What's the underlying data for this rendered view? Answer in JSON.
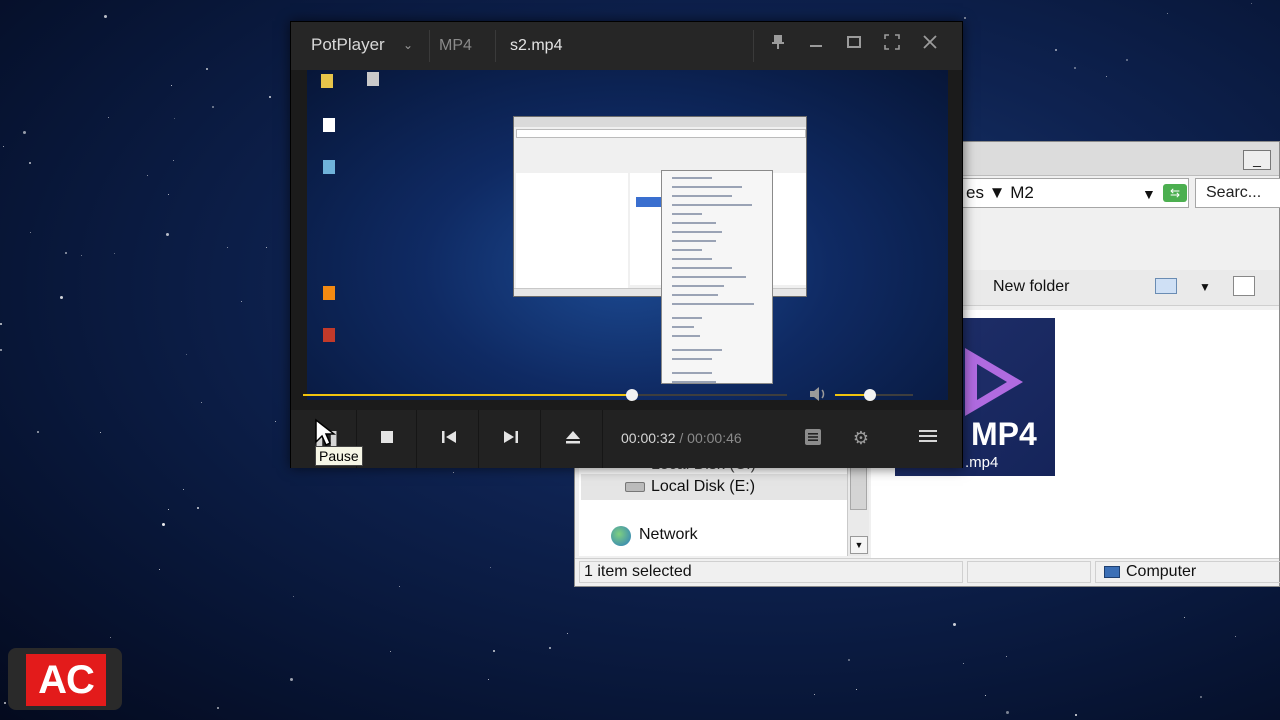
{
  "player": {
    "app_name": "PotPlayer",
    "format": "MP4",
    "file_name": "s2.mp4",
    "time_current": "00:00:32",
    "time_separator": "/",
    "time_total": "00:00:46",
    "seek_progress": 0.68,
    "volume_level": 0.45,
    "tooltip": "Pause"
  },
  "explorer": {
    "address": "es ▼ M2",
    "search_placeholder": "Searc...",
    "new_folder_label": "New folder",
    "nav_partial": "Local Disk (C:)",
    "nav_selected": "Local Disk (E:)",
    "nav_network": "Network",
    "status_text": "1 item selected",
    "status_location": "Computer",
    "file_icon_label": "MP4",
    "file_name": ".mp4"
  },
  "logo": {
    "text": "AC"
  }
}
